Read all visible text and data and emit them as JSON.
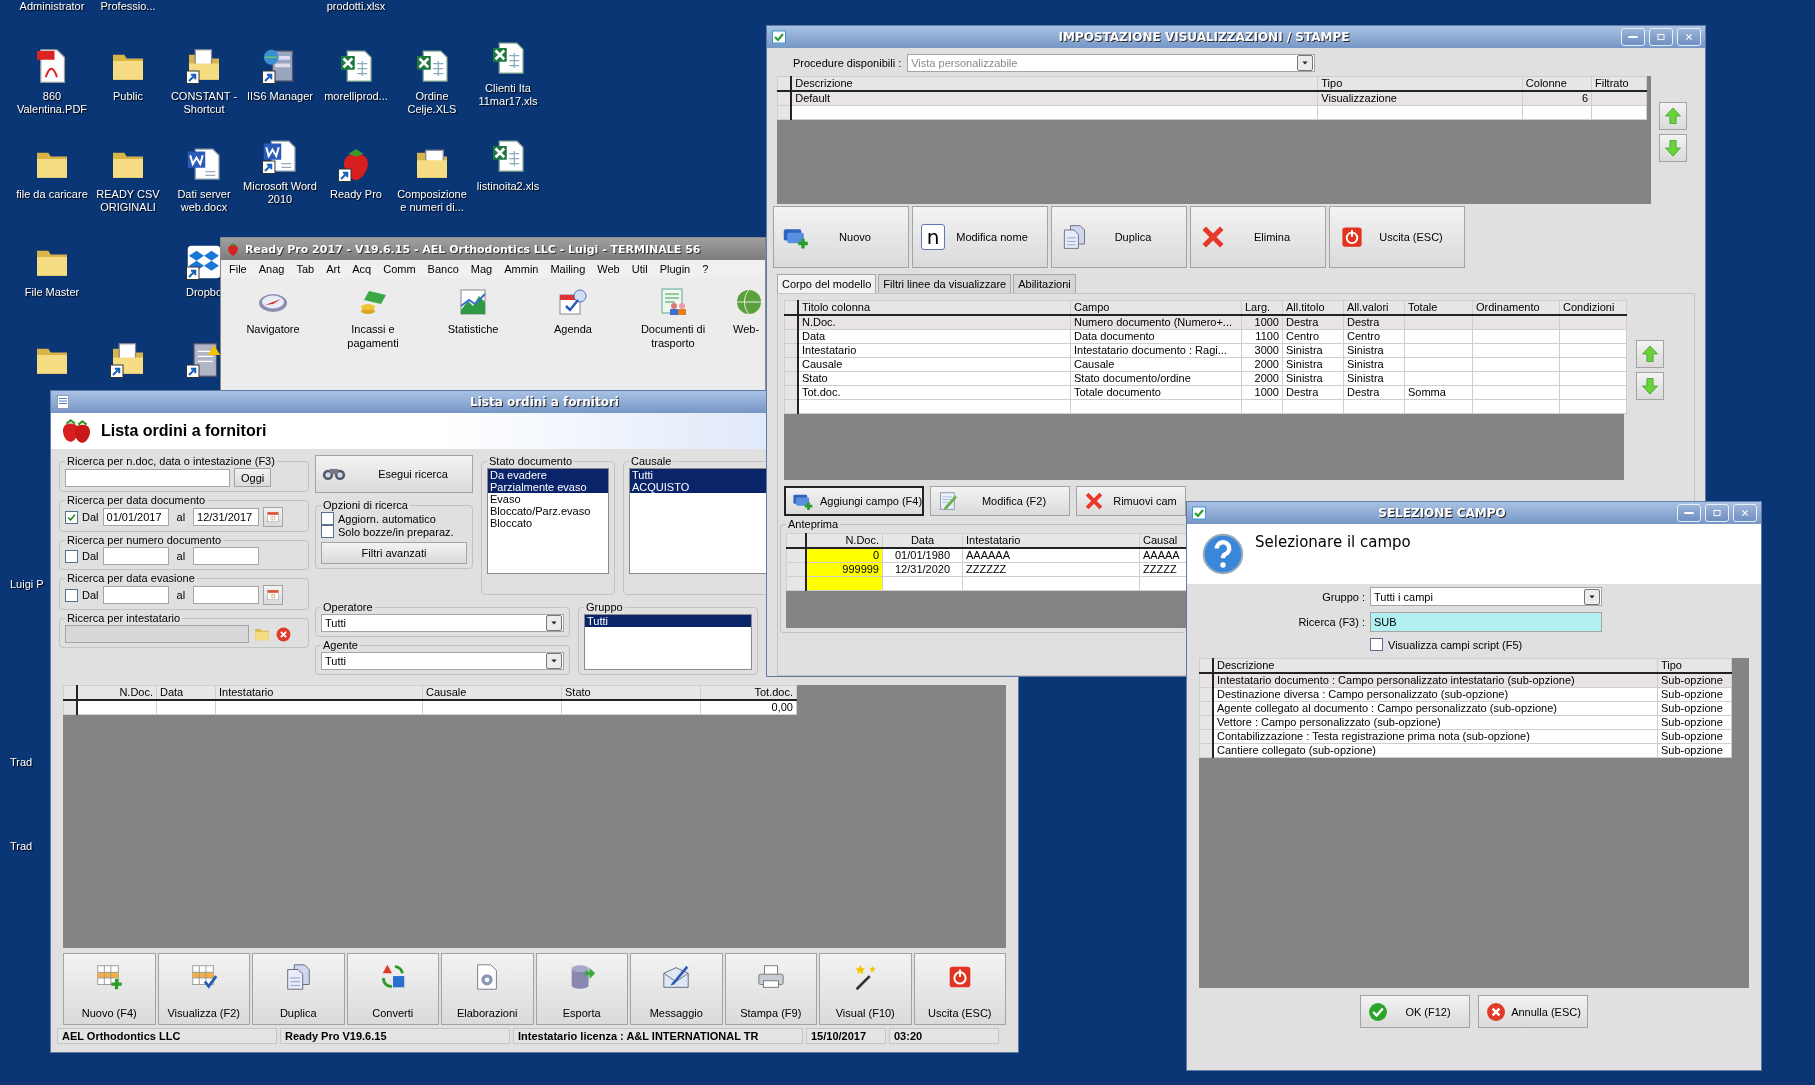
{
  "desktop": {
    "cut_labels": [
      "Administrator",
      "Professio...",
      "prodotti.xlsx"
    ],
    "icon_rows": [
      [
        "860 Valentina.PDF",
        "Public",
        "CONSTANT - Shortcut",
        "IIS6 Manager",
        "morelliprod...",
        "Ordine Celje.XLS",
        "Clienti Ita 11mar17.xls"
      ],
      [
        "file da caricare",
        "READY CSV ORIGINALI",
        "Dati server web.docx",
        "Microsoft Word 2010",
        "Ready Pro",
        "Composizione e numeri di...",
        "listinoita2.xls"
      ],
      [
        "File Master",
        "Dropbo"
      ]
    ],
    "edge_labels": [
      "Luigi P",
      "Trad",
      "Trad"
    ]
  },
  "main_window": {
    "title": "Ready Pro 2017 - V19.6.15 - AEL Orthodontics LLC - Luigi - TERMINALE 56",
    "menu": [
      "File",
      "Anag",
      "Tab",
      "Art",
      "Acq",
      "Comm",
      "Banco",
      "Mag",
      "Ammin",
      "Mailing",
      "Web",
      "Util",
      "Plugin",
      "?"
    ],
    "tools": [
      "Navigatore",
      "Incassi e pagamenti",
      "Statistiche",
      "Agenda",
      "Documenti di trasporto",
      "Web-"
    ]
  },
  "orders_window": {
    "title": "Lista ordini a fornitori",
    "heading": "Lista ordini a fornitori",
    "quick_search": {
      "legend": "Ricerca per n.doc, data o intestazione (F3)",
      "button": "Oggi"
    },
    "date_ranges": [
      {
        "legend": "Ricerca per data documento",
        "checked": true,
        "check_label": "Dal",
        "from": "01/01/2017",
        "to_label": "al",
        "to": "12/31/2017",
        "calendar": true
      },
      {
        "legend": "Ricerca per numero documento",
        "checked": false,
        "check_label": "Dal",
        "to_label": "al",
        "calendar": false
      },
      {
        "legend": "Ricerca per data evasione",
        "checked": false,
        "check_label": "Dal",
        "to_label": "al",
        "calendar": true
      }
    ],
    "holder_search": {
      "legend": "Ricerca per intestatario"
    },
    "search_button": "Esegui ricerca",
    "options": {
      "legend": "Opzioni di ricerca",
      "items": [
        {
          "label": "Aggiorn. automatico",
          "checked": false
        },
        {
          "label": "Solo bozze/in preparaz.",
          "checked": false
        }
      ],
      "button": "Filtri avanzati"
    },
    "status_list": {
      "legend": "Stato documento",
      "items": [
        {
          "label": "Da evadere",
          "selected": true
        },
        {
          "label": "Parzialmente evaso",
          "selected": true
        },
        {
          "label": "Evaso",
          "selected": false
        },
        {
          "label": "Bloccato/Parz.evaso",
          "selected": false
        },
        {
          "label": "Bloccato",
          "selected": false
        }
      ]
    },
    "reason_list": {
      "legend": "Causale",
      "items": [
        {
          "label": "Tutti",
          "selected": true
        },
        {
          "label": "ACQUISTO",
          "selected": true
        }
      ]
    },
    "operator": {
      "legend": "Operatore",
      "value": "Tutti"
    },
    "agent": {
      "legend": "Agente",
      "value": "Tutti"
    },
    "group_list": {
      "legend": "Gruppo",
      "items": [
        {
          "label": "Tutti",
          "selected": true
        }
      ]
    },
    "table": {
      "columns": [
        "N.Doc.",
        "Data",
        "Intestatario",
        "Causale",
        "Stato",
        "Tot.doc."
      ],
      "rows": [
        {
          "total": "0,00"
        }
      ]
    },
    "buttons": [
      "Nuovo (F4)",
      "Visualizza (F2)",
      "Duplica",
      "Converti",
      "Elaborazioni",
      "Esporta",
      "Messaggio",
      "Stampa (F9)",
      "Visual (F10)",
      "Uscita (ESC)"
    ],
    "status_bar": [
      "AEL Orthodontics LLC",
      "Ready Pro V19.6.15",
      "Intestatario licenza : A&L INTERNATIONAL TR",
      "15/10/2017",
      "03:20"
    ]
  },
  "settings_window": {
    "title": "IMPOSTAZIONE VISUALIZZAZIONI / STAMPE",
    "procedure": {
      "label": "Procedure disponibili :",
      "value": "Vista personalizzabile"
    },
    "views": {
      "columns": [
        "Descrizione",
        "Tipo",
        "Colonne",
        "Filtrato"
      ],
      "rows": [
        {
          "cells": [
            "Default",
            "Visualizzazione",
            "6"
          ],
          "selected": true
        }
      ]
    },
    "buttons": [
      {
        "label": "Nuovo"
      },
      {
        "label": "Modifica nome",
        "glyph": "n"
      },
      {
        "label": "Duplica"
      },
      {
        "label": "Elimina"
      },
      {
        "label": "Uscita (ESC)"
      }
    ],
    "tabs": [
      {
        "label": "Corpo del modello",
        "selected": true
      },
      {
        "label": "Filtri linee da visualizzare",
        "selected": false
      },
      {
        "label": "Abilitazioni",
        "selected": false
      }
    ],
    "columns_table": {
      "columns": [
        "Titolo colonna",
        "Campo",
        "Larg.",
        "All.titolo",
        "All.valori",
        "Totale",
        "Ordinamento",
        "Condizioni"
      ],
      "rows": [
        {
          "cells": [
            "N.Doc.",
            "Numero documento (Numero+...",
            "1000",
            "Destra",
            "Destra"
          ],
          "selected": true
        },
        {
          "cells": [
            "Data",
            "Data documento",
            "1100",
            "Centro",
            "Centro"
          ],
          "selected": false
        },
        {
          "cells": [
            "Intestatario",
            "Intestatario documento : Ragi...",
            "3000",
            "Sinistra",
            "Sinistra"
          ],
          "selected": false
        },
        {
          "cells": [
            "Causale",
            "Causale",
            "2000",
            "Sinistra",
            "Sinistra"
          ],
          "selected": false
        },
        {
          "cells": [
            "Stato",
            "Stato documento/ordine",
            "2000",
            "Sinistra",
            "Sinistra"
          ],
          "selected": false
        },
        {
          "cells": [
            "Tot.doc.",
            "Totale documento",
            "1000",
            "Destra",
            "Destra",
            "Somma"
          ],
          "selected": false
        }
      ]
    },
    "field_buttons": [
      "Aggiungi campo (F4)",
      "Modifica (F2)",
      "Rimuovi cam"
    ],
    "preview": {
      "legend": "Anteprima",
      "columns": [
        "N.Doc.",
        "Data",
        "Intestatario",
        "Causal"
      ],
      "rows": [
        [
          "0",
          "01/01/1980",
          "AAAAAA",
          "AAAAA"
        ],
        [
          "999999",
          "12/31/2020",
          "ZZZZZZ",
          "ZZZZZ"
        ]
      ]
    }
  },
  "field_dialog": {
    "title": "SELEZIONE CAMPO",
    "heading": "Selezionare il campo",
    "group": {
      "label": "Gruppo :",
      "value": "Tutti i campi"
    },
    "search": {
      "label": "Ricerca (F3) :",
      "value": "SUB"
    },
    "script_check": {
      "label": "Visualizza campi script (F5)",
      "checked": false
    },
    "table": {
      "columns": [
        "Descrizione",
        "Tipo"
      ],
      "rows": [
        {
          "cells": [
            "Intestatario documento : Campo personalizzato intestatario (sub-opzione)",
            "Sub-opzione"
          ],
          "selected": true
        },
        {
          "cells": [
            "Destinazione diversa : Campo personalizzato (sub-opzione)",
            "Sub-opzione"
          ],
          "selected": false
        },
        {
          "cells": [
            "Agente collegato al documento : Campo personalizzato (sub-opzione)",
            "Sub-opzione"
          ],
          "selected": false
        },
        {
          "cells": [
            "Vettore : Campo personalizzato (sub-opzione)",
            "Sub-opzione"
          ],
          "selected": false
        },
        {
          "cells": [
            "Contabilizzazione : Testa registrazione prima nota (sub-opzione)",
            "Sub-opzione"
          ],
          "selected": false
        },
        {
          "cells": [
            "Cantiere collegato (sub-opzione)",
            "Sub-opzione"
          ],
          "selected": false
        }
      ]
    },
    "buttons": [
      "OK (F12)",
      "Annulla (ESC)"
    ]
  }
}
